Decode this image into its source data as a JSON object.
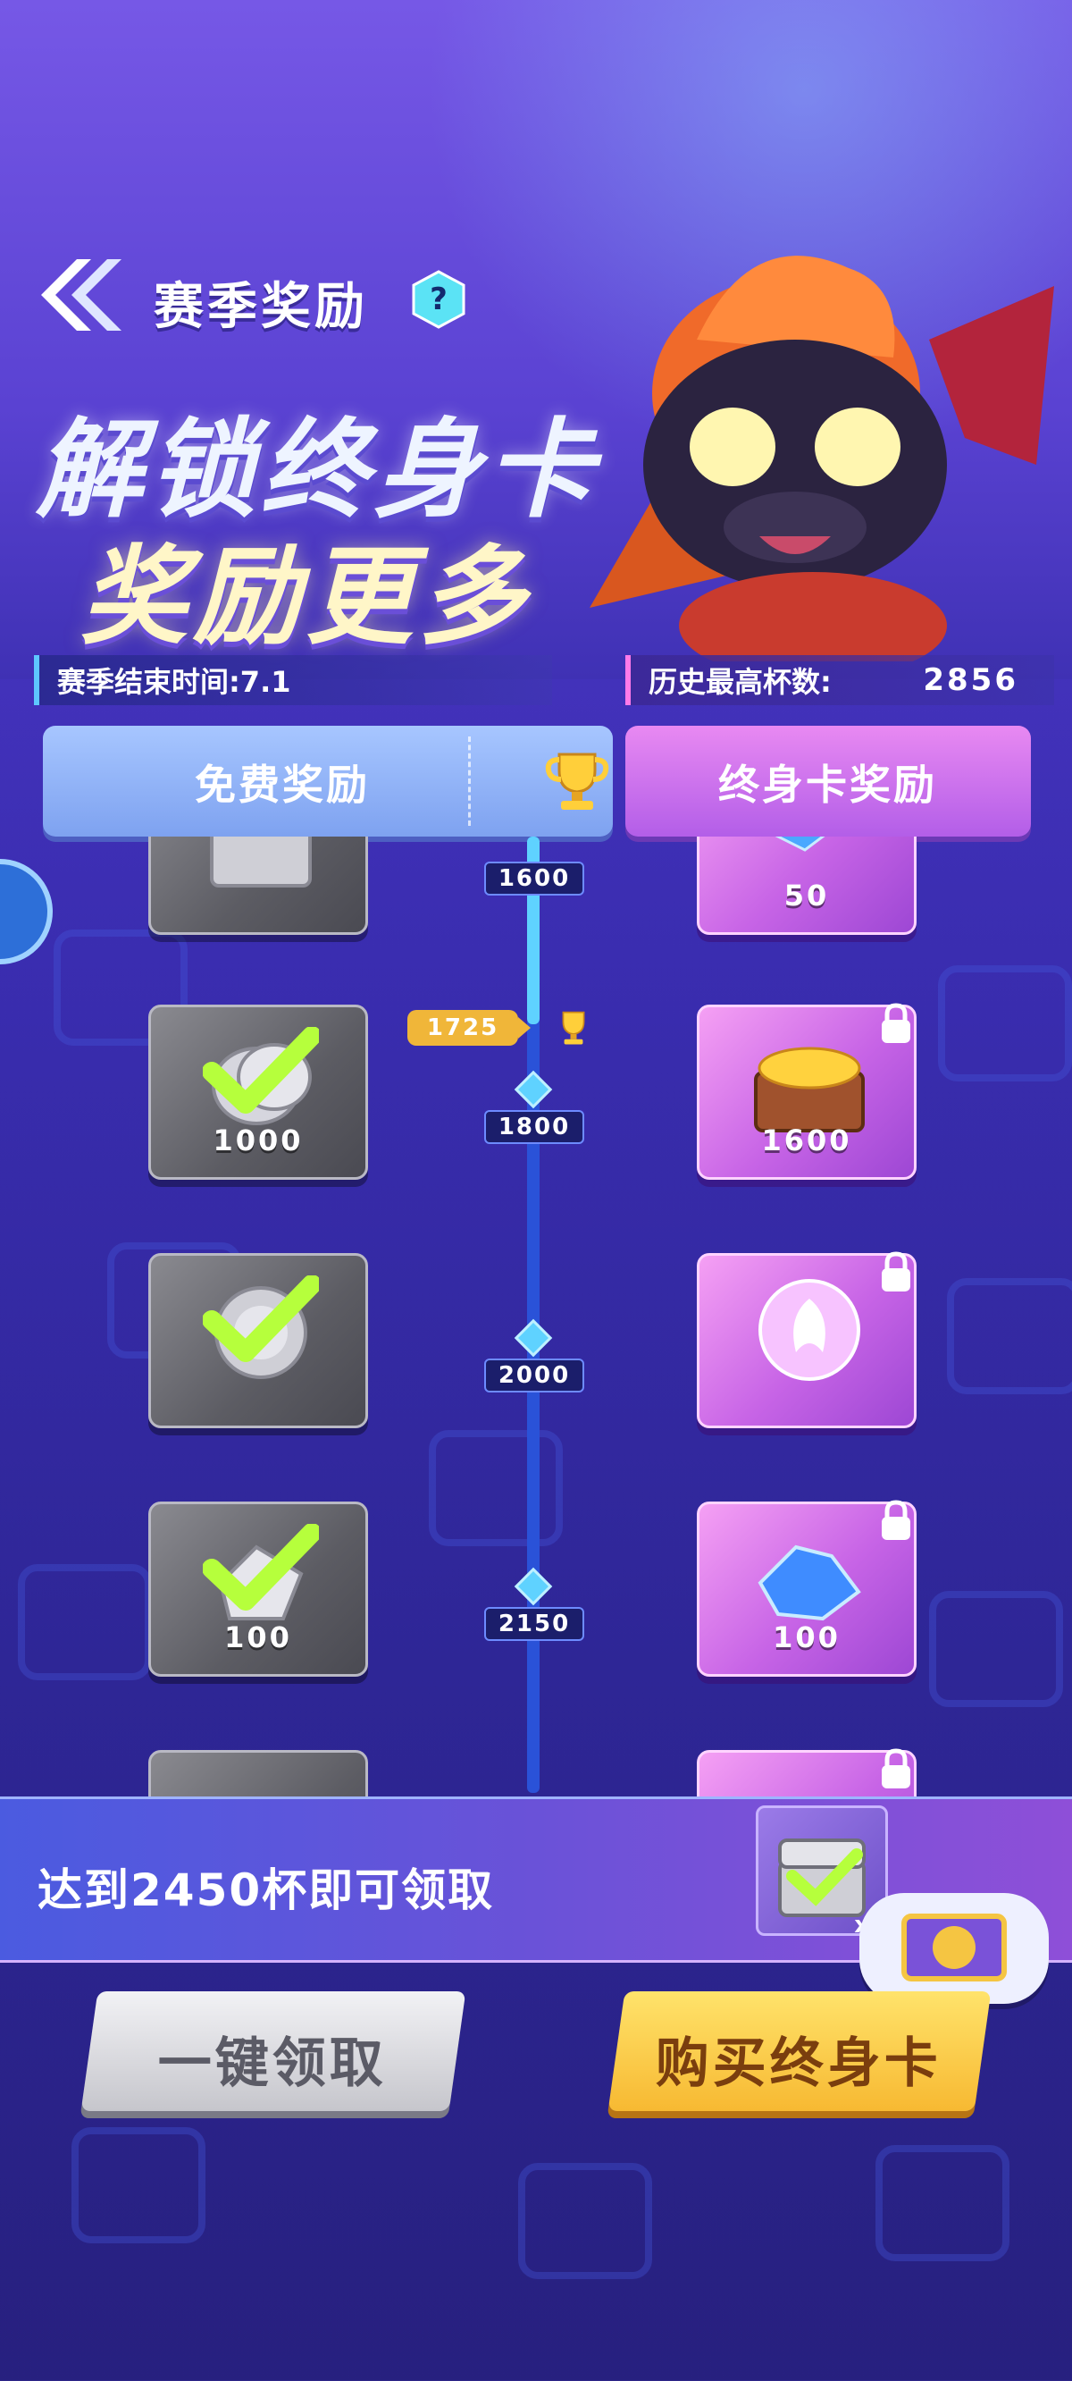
{
  "header": {
    "title": "赛季奖励",
    "help_glyph": "?",
    "banner_line1": "解锁终身卡",
    "banner_line2": "奖励更多"
  },
  "info": {
    "season_end": "赛季结束时间:7.1",
    "best_label": "历史最高杯数:",
    "best_value": "2856"
  },
  "tabs": {
    "free": "免费奖励",
    "lifetime": "终身卡奖励"
  },
  "progress": {
    "current": "1725",
    "milestones": [
      "1600",
      "1800",
      "2000",
      "2150"
    ]
  },
  "rewards": [
    {
      "milestone": "1600",
      "free_amount": "",
      "free_icon": "chest-icon",
      "free_claimed": true,
      "life_amount": "50",
      "life_icon": "gem-icon",
      "life_locked": true
    },
    {
      "milestone": "1800",
      "free_amount": "1000",
      "free_icon": "coin-icon",
      "free_claimed": true,
      "life_amount": "1600",
      "life_icon": "treasure-chest-icon",
      "life_locked": true
    },
    {
      "milestone": "2000",
      "free_amount": "",
      "free_icon": "badge-icon",
      "free_claimed": true,
      "life_amount": "",
      "life_icon": "phoenix-emblem-icon",
      "life_locked": true
    },
    {
      "milestone": "2150",
      "free_amount": "100",
      "free_icon": "gem-icon",
      "free_claimed": true,
      "life_amount": "100",
      "life_icon": "gem-icon",
      "life_locked": true
    }
  ],
  "footer": {
    "reach_text": "达到2450杯即可领取",
    "preview_multiplier": "x",
    "claim_all": "一键领取",
    "buy_card": "购买终身卡"
  },
  "colors": {
    "track": "#2a52d8",
    "track_fill": "#5fd2ff",
    "current_pill": "#f0b639",
    "free_tab": "#8ea9f3",
    "lifetime_tab": "#c771ec",
    "buy_button": "#f7c844"
  }
}
